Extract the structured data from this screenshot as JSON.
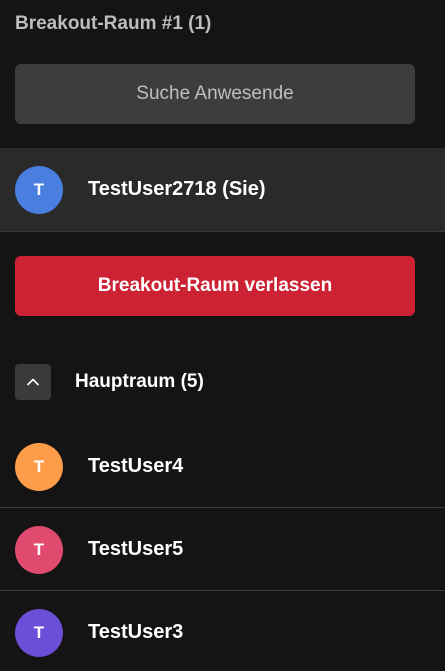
{
  "breakout_room": {
    "title": "Breakout-Raum #1 (1)",
    "search_label": "Suche Anwesende",
    "self_user": {
      "initial": "T",
      "name": "TestUser2718 (Sie)",
      "avatar_color": "#4a7fe0"
    },
    "leave_label": "Breakout-Raum verlassen",
    "leave_color": "#cc2233"
  },
  "main_room": {
    "title": "Hauptraum (5)",
    "collapsed": false,
    "users": [
      {
        "initial": "T",
        "name": "TestUser4",
        "avatar_color": "#ff9c4a"
      },
      {
        "initial": "T",
        "name": "TestUser5",
        "avatar_color": "#e04a6e"
      },
      {
        "initial": "T",
        "name": "TestUser3",
        "avatar_color": "#6b4fd6"
      }
    ]
  }
}
